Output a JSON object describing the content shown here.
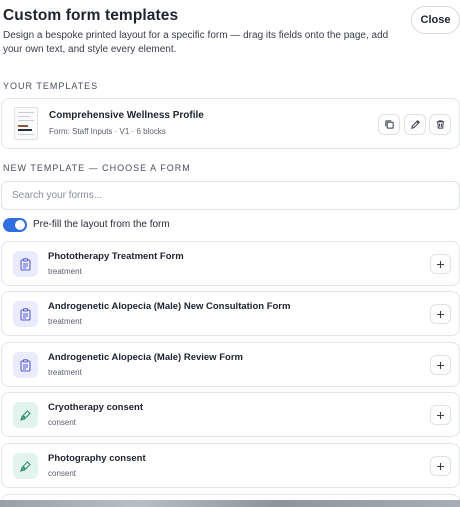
{
  "header": {
    "title": "Custom form templates",
    "description": "Design a bespoke printed layout for a specific form — drag its fields onto the page, add your own text, and style every element.",
    "close_label": "Close"
  },
  "your_templates": {
    "label": "YOUR TEMPLATES",
    "items": [
      {
        "name": "Comprehensive Wellness Profile",
        "meta": "Form: Staff Inputs · V1 · 6 blocks",
        "actions": [
          "duplicate-icon",
          "edit-icon",
          "delete-icon"
        ]
      }
    ]
  },
  "new_template": {
    "label": "NEW TEMPLATE — CHOOSE A FORM",
    "search_placeholder": "Search your forms...",
    "prefill_label": "Pre-fill the layout from the form",
    "prefill_on": true,
    "forms": [
      {
        "name": "Phototherapy Treatment Form",
        "category": "treatment",
        "icon": "clipboard-icon"
      },
      {
        "name": "Androgenetic Alopecia (Male) New Consultation Form",
        "category": "treatment",
        "icon": "clipboard-icon"
      },
      {
        "name": "Androgenetic Alopecia (Male) Review Form",
        "category": "treatment",
        "icon": "clipboard-icon"
      },
      {
        "name": "Cryotherapy consent",
        "category": "consent",
        "icon": "pen-icon"
      },
      {
        "name": "Photography consent",
        "category": "consent",
        "icon": "pen-icon"
      }
    ]
  },
  "colors": {
    "accent": "#2f6fe0",
    "treatment_icon_bg": "#ebecfb",
    "treatment_icon_fg": "#5b5fd6",
    "consent_icon_bg": "#e3f4ee",
    "consent_icon_fg": "#2f8f6e"
  }
}
